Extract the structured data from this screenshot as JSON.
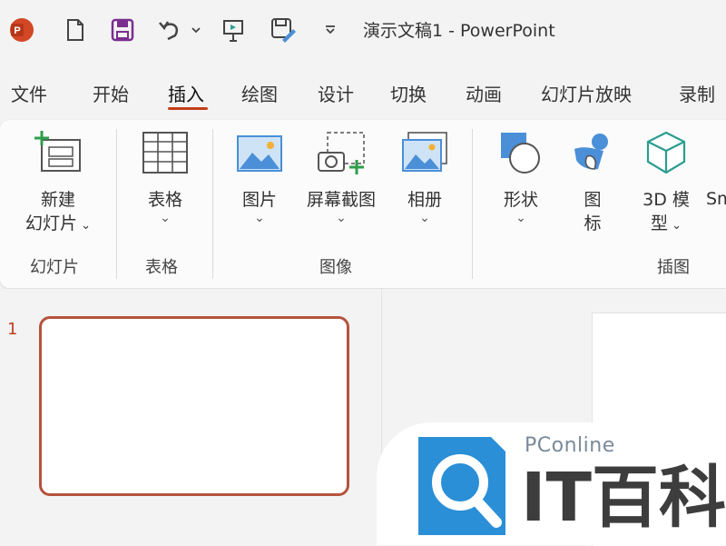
{
  "window": {
    "title": "演示文稿1  -  PowerPoint"
  },
  "quick_access": {
    "icons": [
      "powerpoint-logo-icon",
      "new-file-icon",
      "save-icon",
      "undo-icon",
      "dropdown-icon",
      "present-icon",
      "save-as-icon",
      "customize-icon"
    ]
  },
  "tabs": [
    {
      "label": "文件"
    },
    {
      "label": "开始"
    },
    {
      "label": "插入",
      "active": true
    },
    {
      "label": "绘图"
    },
    {
      "label": "设计"
    },
    {
      "label": "切换"
    },
    {
      "label": "动画"
    },
    {
      "label": "幻灯片放映"
    },
    {
      "label": "录制"
    }
  ],
  "ribbon": {
    "groups": {
      "slides": {
        "label": "幻灯片"
      },
      "tables": {
        "label": "表格"
      },
      "images": {
        "label": "图像"
      },
      "illustrations": {
        "label": "插图"
      }
    },
    "buttons": {
      "new_slide_line1": "新建",
      "new_slide_line2": "幻灯片",
      "table": "表格",
      "picture": "图片",
      "screenshot": "屏幕截图",
      "album": "相册",
      "shapes": "形状",
      "icons_line1": "图",
      "icons_line2": "标",
      "model_line1": "3D 模",
      "model_line2": "型",
      "smartart_partial": "Sm"
    }
  },
  "slides_panel": {
    "slide_number": "1"
  },
  "watermark": {
    "brand": "PConline",
    "text": "IT百科"
  },
  "colors": {
    "accent": "#c43e1c",
    "slide_border": "#b5533c",
    "icon_blue": "#4a8fd8"
  }
}
